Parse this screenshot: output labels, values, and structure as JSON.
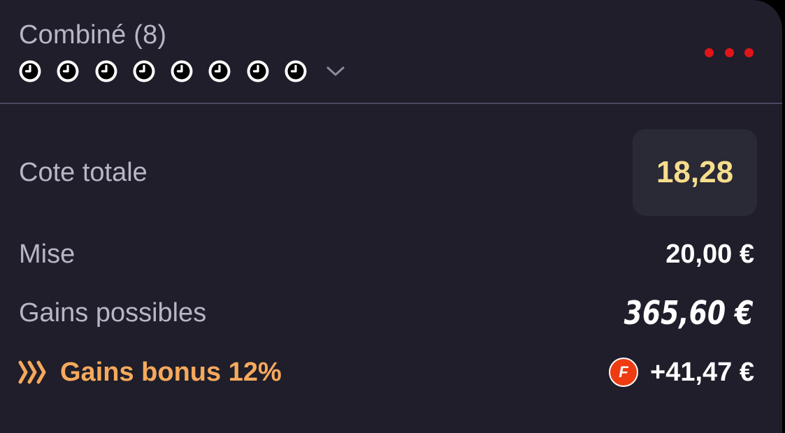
{
  "header": {
    "title": "Combiné (8)",
    "selections_count": 8,
    "selection_status_icon": "clock-icon",
    "expand_icon": "chevron-down-icon",
    "more_icon": "more-dots-icon"
  },
  "summary": {
    "total_odds_label": "Cote totale",
    "total_odds_value": "18,28",
    "stake_label": "Mise",
    "stake_value": "20,00 €",
    "potential_winnings_label": "Gains possibles",
    "potential_winnings_value": "365,60 €",
    "bonus_label": "Gains bonus 12%",
    "bonus_icon": "triple-chevron-right-icon",
    "bonus_badge_letter": "F",
    "bonus_value": "+41,47 €"
  },
  "colors": {
    "card_background": "#1f1e2a",
    "odds_box_background": "#2a2936",
    "odds_text": "#f6dd8c",
    "bonus_accent": "#f6a95c",
    "more_dots": "#e0151a",
    "freebet_badge": "#ee3b12",
    "label_text": "#b8b6c6"
  }
}
